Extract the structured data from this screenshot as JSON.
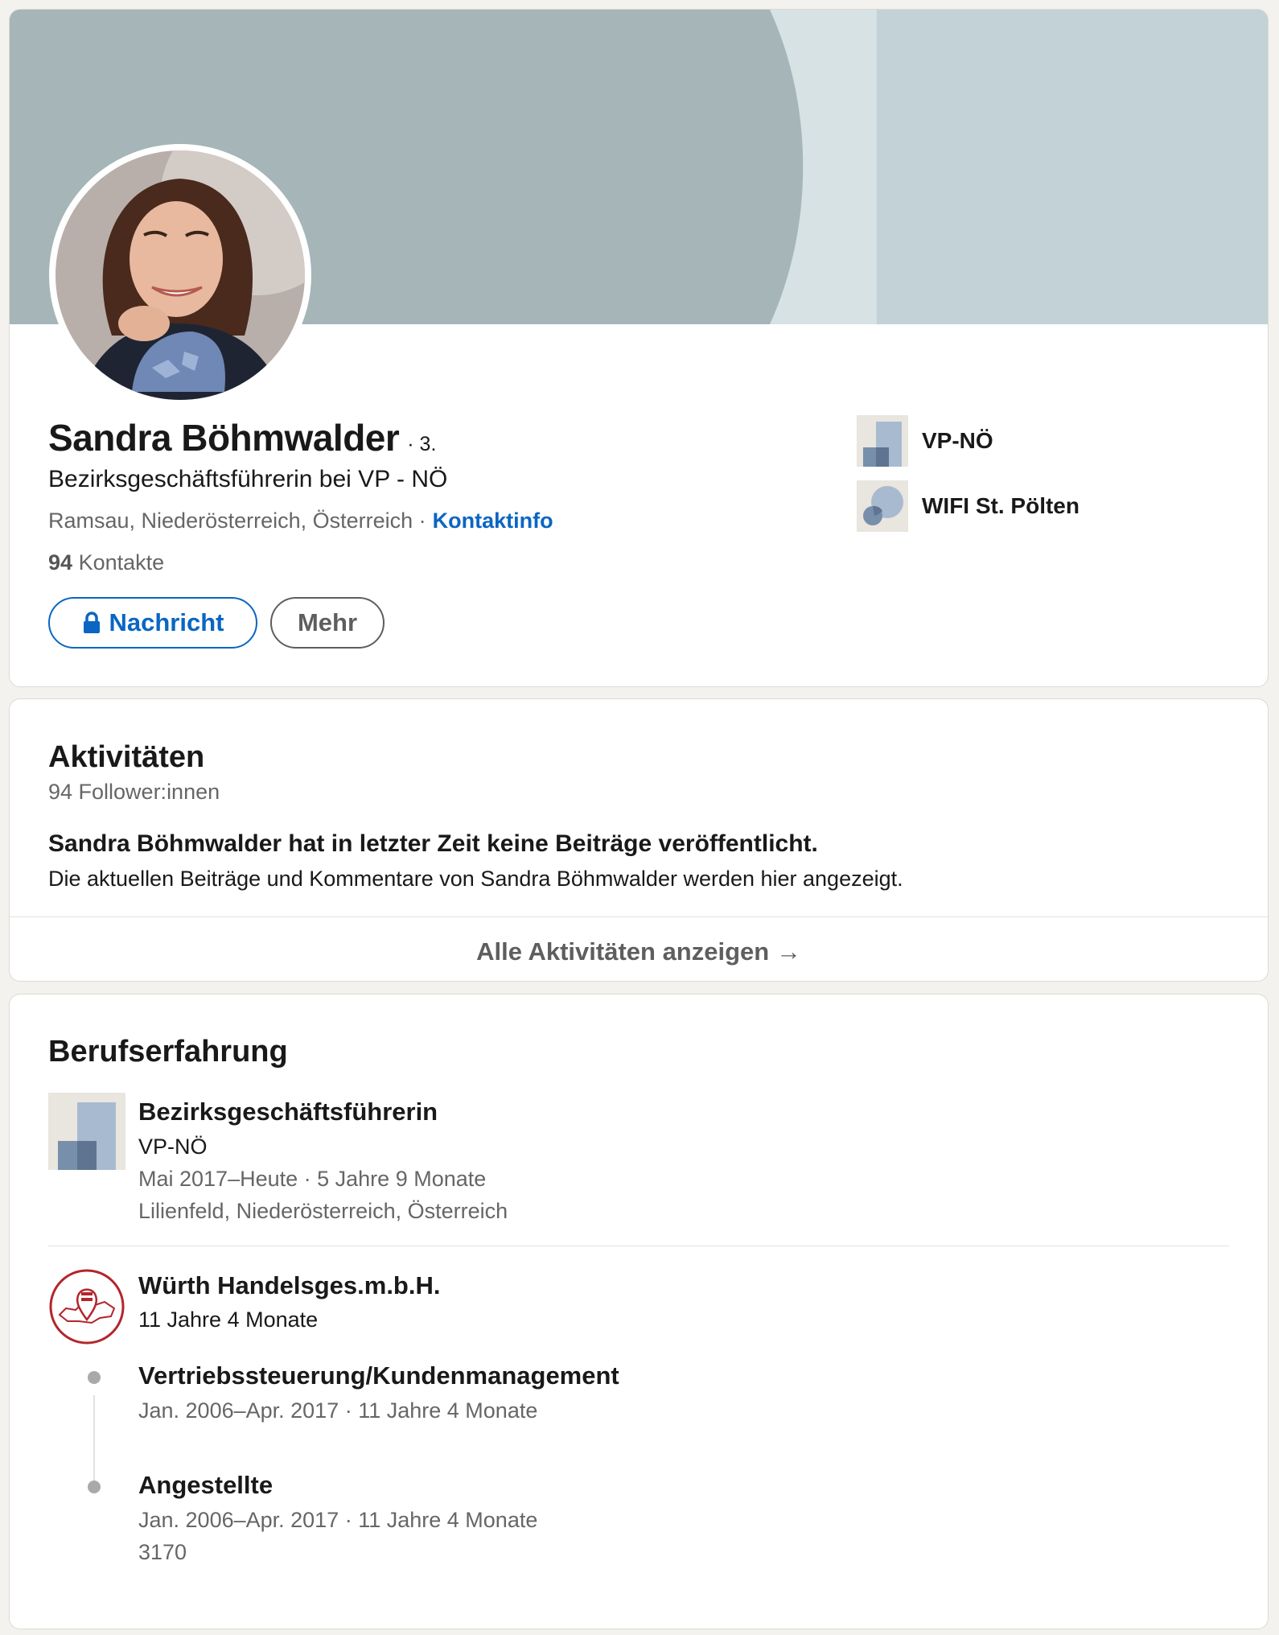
{
  "profile": {
    "name": "Sandra Böhmwalder",
    "degree": "· 3.",
    "headline": "Bezirksgeschäftsführerin bei VP - NÖ",
    "location": "Ramsau, Niederösterreich, Österreich ·",
    "contact_info_label": "Kontaktinfo",
    "connections_count": "94",
    "connections_label": "Kontakte",
    "message_button": "Nachricht",
    "more_button": "Mehr",
    "organizations": [
      {
        "name": "VP-NÖ",
        "icon": "company-logo-placeholder"
      },
      {
        "name": "WIFI St. Pölten",
        "icon": "school-logo-placeholder"
      }
    ],
    "colors": {
      "accent": "#0a66c2",
      "banner": "#a5b5b8"
    }
  },
  "activity": {
    "title": "Aktivitäten",
    "followers": "94 Follower:innen",
    "empty_title": "Sandra Böhmwalder hat in letzter Zeit keine Beiträge veröffentlicht.",
    "empty_text": "Die aktuellen Beiträge und Kommentare von Sandra Böhmwalder werden hier angezeigt.",
    "show_all": "Alle Aktivitäten anzeigen →"
  },
  "experience": {
    "title": "Berufserfahrung",
    "items": [
      {
        "title": "Bezirksgeschäftsführerin",
        "company": "VP-NÖ",
        "dates": "Mai 2017–Heute · 5 Jahre 9 Monate",
        "location": "Lilienfeld, Niederösterreich, Österreich"
      },
      {
        "company": "Würth Handelsges.m.b.H.",
        "duration": "11 Jahre 4 Monate",
        "roles": [
          {
            "title": "Vertriebssteuerung/Kundenmanagement",
            "dates": "Jan. 2006–Apr. 2017 · 11 Jahre 4 Monate"
          },
          {
            "title": "Angestellte",
            "dates": "Jan. 2006–Apr. 2017 · 11 Jahre 4 Monate",
            "extra": "3170"
          }
        ]
      }
    ]
  }
}
